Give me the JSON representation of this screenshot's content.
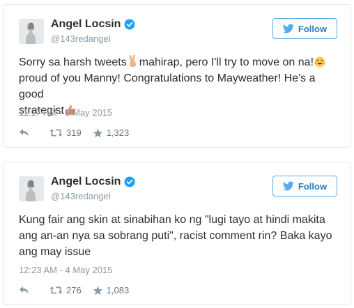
{
  "tweets": [
    {
      "name": "Angel Locsin",
      "handle": "@143redangel",
      "follow_label": "Follow",
      "text_line1": "Sorry sa harsh tweets",
      "text_line1b": "mahirap, pero I'll try to move on na!",
      "text_line2": "proud of you Manny! Congratulations to Mayweather! He's a good",
      "text_line3": "strategist",
      "timestamp": "11:17 PM - 3 May 2015",
      "retweets": "319",
      "likes": "1,323",
      "emoji_icons": [
        "victory-hand-icon",
        "tears-of-joy-icon",
        "thumbs-up-icon"
      ]
    },
    {
      "name": "Angel Locsin",
      "handle": "@143redangel",
      "follow_label": "Follow",
      "text_line1": "Kung fair ang skin at sinabihan ko ng \"lugi tayo at hindi makita",
      "text_line2": "ang an-an nya sa sobrang puti\", racist comment rin? Baka kayo",
      "text_line3": "ang may issue",
      "timestamp": "12:23 AM - 4 May 2015",
      "retweets": "276",
      "likes": "1,083"
    }
  ],
  "colors": {
    "twitter_blue": "#55acee",
    "verified_blue": "#1da1f2",
    "meta_gray": "#8899a6",
    "text": "#292f33",
    "border": "#e1e8ed"
  }
}
